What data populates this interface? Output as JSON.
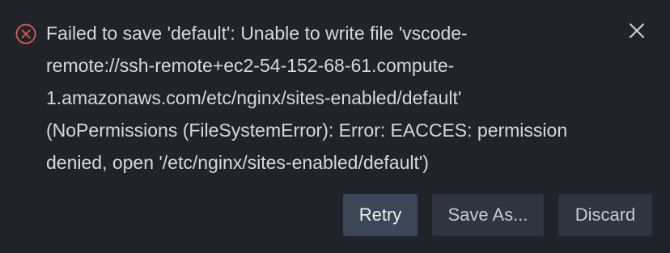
{
  "notification": {
    "severity_icon": "error-circle-icon",
    "message_lines": [
      "Failed to save 'default': Unable to write file 'vscode-",
      "remote://ssh-remote+ec2-54-152-68-61.compute-",
      "1.amazonaws.com/etc/nginx/sites-enabled/default'",
      "(NoPermissions (FileSystemError): Error: EACCES: permission",
      "denied, open '/etc/nginx/sites-enabled/default')"
    ],
    "close_icon": "close-icon",
    "actions": {
      "retry_label": "Retry",
      "save_as_label": "Save As...",
      "discard_label": "Discard"
    }
  },
  "colors": {
    "background": "#20242a",
    "text": "#d6d8dc",
    "error_red": "#e05a4f",
    "primary_button": "#3c4657",
    "secondary_button": "#2f353e"
  }
}
